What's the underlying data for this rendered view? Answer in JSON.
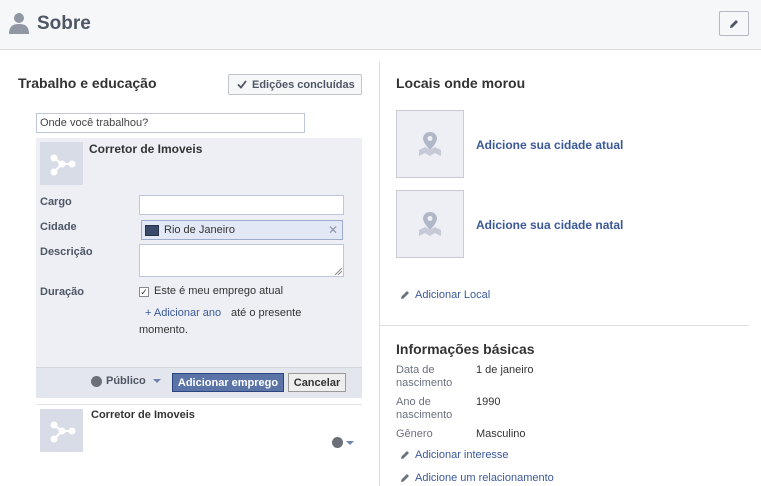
{
  "header": {
    "title": "Sobre"
  },
  "work": {
    "section_title": "Trabalho e educação",
    "done_label": "Edições concluídas",
    "search_placeholder": "Onde você trabalhou?",
    "employer": "Corretor de Imoveis",
    "labels": {
      "position": "Cargo",
      "city": "Cidade",
      "description": "Descrição",
      "duration": "Duração"
    },
    "city_value": "Rio de Janeiro",
    "current_job_label": "Este é meu emprego atual",
    "current_job_checked": true,
    "add_year_link": "+ Adicionar ano",
    "until_present_1": "até o presente",
    "until_present_2": "momento.",
    "privacy_label": "Público",
    "add_job_label": "Adicionar emprego",
    "cancel_label": "Cancelar",
    "existing_job": "Corretor de Imoveis"
  },
  "places": {
    "section_title": "Locais onde morou",
    "current_city_link": "Adicione sua cidade atual",
    "hometown_link": "Adicione sua cidade natal",
    "add_place_link": "Adicionar Local"
  },
  "basic_info": {
    "section_title": "Informações básicas",
    "birth_date_label_1": "Data de",
    "birth_date_label_2": "nascimento",
    "birth_date_value": "1 de janeiro",
    "birth_year_label_1": "Ano de",
    "birth_year_label_2": "nascimento",
    "birth_year_value": "1990",
    "gender_label": "Gênero",
    "gender_value": "Masculino",
    "add_interest_link": "Adicionar interesse",
    "add_relationship_link": "Adicione um relacionamento"
  },
  "colors": {
    "link": "#3b5998",
    "primary_button": "#5b74a8",
    "panel_bg": "#edeff4"
  }
}
